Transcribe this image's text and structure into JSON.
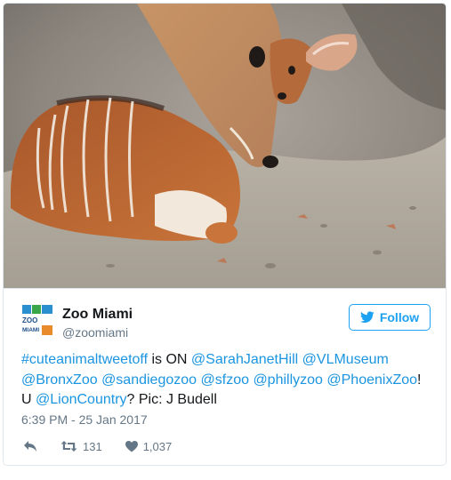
{
  "tweet": {
    "display_name": "Zoo Miami",
    "screen_name": "@zoomiami",
    "follow_label": "Follow",
    "text_parts": [
      {
        "text": "#cuteanimaltweetoff",
        "link": true
      },
      {
        "text": " is ON ",
        "link": false
      },
      {
        "text": "@SarahJanetHill",
        "link": true
      },
      {
        "text": " ",
        "link": false
      },
      {
        "text": "@VLMuseum",
        "link": true
      },
      {
        "text": " ",
        "link": false
      },
      {
        "text": "@BronxZoo",
        "link": true
      },
      {
        "text": " ",
        "link": false
      },
      {
        "text": "@sandiegozoo",
        "link": true
      },
      {
        "text": " ",
        "link": false
      },
      {
        "text": "@sfzoo",
        "link": true
      },
      {
        "text": " ",
        "link": false
      },
      {
        "text": "@phillyzoo",
        "link": true
      },
      {
        "text": " ",
        "link": false
      },
      {
        "text": "@PhoenixZoo",
        "link": true
      },
      {
        "text": "! U ",
        "link": false
      },
      {
        "text": "@LionCountry",
        "link": true
      },
      {
        "text": "? Pic: J Budell",
        "link": false
      }
    ],
    "timestamp": "6:39 PM - 25 Jan 2017",
    "retweet_count": "131",
    "like_count": "1,037",
    "avatar_logo_text": [
      "ZOO",
      "MIAMI"
    ]
  },
  "icons": {
    "reply": "reply-icon",
    "retweet": "retweet-icon",
    "like": "heart-icon",
    "follow": "bird-icon"
  },
  "colors": {
    "link": "#1b95e0",
    "brand": "#1da1f2",
    "meta": "#657786",
    "border": "#e1e8ed"
  }
}
